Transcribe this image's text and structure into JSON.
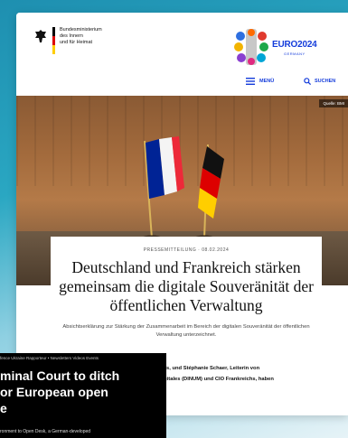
{
  "header": {
    "ministry_lines": [
      "Bundesministerium",
      "des Innern",
      "und für Heimat"
    ],
    "euro_title": "EURO2024",
    "euro_sub": "GERMANY",
    "menu_label": "MENÜ",
    "search_label": "SUCHEN"
  },
  "hero": {
    "credit": "Quelle: BMI"
  },
  "article": {
    "kicker": "PRESSEMITTEILUNG · 08.02.2024",
    "headline": "Deutschland und Frankreich stär­ken gemeinsam die digitale Souve­ränität der öffentlichen Verwaltung",
    "subline": "Absichtserklärung zur Stärkung der Zusammenarbeit im Bereich der digitalen Souveränität der öffentlichen Verwaltung unterzeichnet.",
    "body_lines": [
      "Bundes, und Stéphanie Schaer, Leiterin von",
      "für Digitales (DINUM) und CIO Frankreichs, haben"
    ]
  },
  "overlay": {
    "nav": "fence  Ukraine  Rapporteur  •  Newsletters  Videos  Events",
    "title_lines": [
      "minal Court to ditch",
      "or European open",
      "e"
    ],
    "subtitle": "ronment to Open Desk, a German-developed"
  },
  "colors": {
    "brand_blue": "#143cdb",
    "overlay_bg": "#000000"
  }
}
